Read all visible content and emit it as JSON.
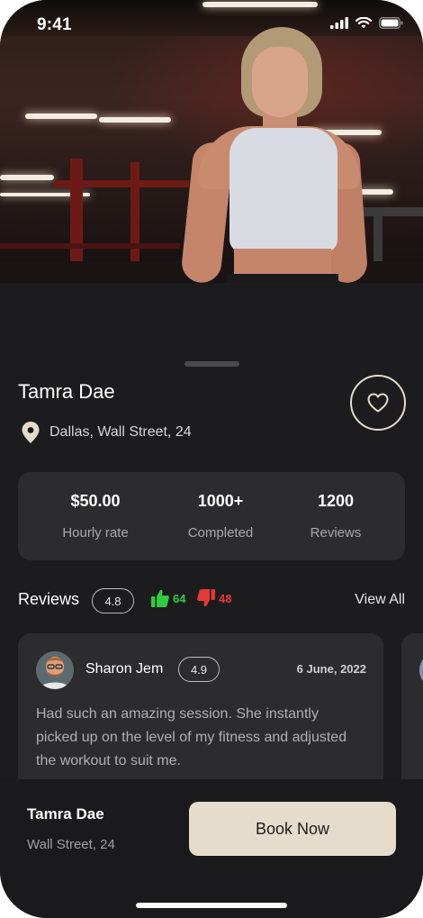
{
  "status_bar": {
    "time": "9:41"
  },
  "trainer": {
    "name": "Tamra Dae",
    "location": "Dallas, Wall Street, 24"
  },
  "stats": [
    {
      "value": "$50.00",
      "label": "Hourly rate"
    },
    {
      "value": "1000+",
      "label": "Completed"
    },
    {
      "value": "1200",
      "label": "Reviews"
    }
  ],
  "reviews": {
    "title": "Reviews",
    "rating": "4.8",
    "likes": "64",
    "dislikes": "48",
    "view_all": "View All",
    "items": [
      {
        "name": "Sharon Jem",
        "rating": "4.9",
        "date": "6 June, 2022",
        "text": "Had such an amazing session. She instantly picked up on the level of my fitness and adjusted the workout to suit me."
      }
    ]
  },
  "bottom_bar": {
    "name": "Tamra Dae",
    "address": "Wall Street, 24",
    "book_label": "Book Now"
  },
  "colors": {
    "background": "#1c1c1e",
    "card": "#2c2c2e",
    "accent": "#e5dccb",
    "like": "#2ecc40",
    "dislike": "#e53935"
  },
  "icons": [
    "location-pin-icon",
    "heart-icon",
    "thumbs-up-icon",
    "thumbs-down-icon",
    "signal-icon",
    "wifi-icon",
    "battery-icon"
  ]
}
